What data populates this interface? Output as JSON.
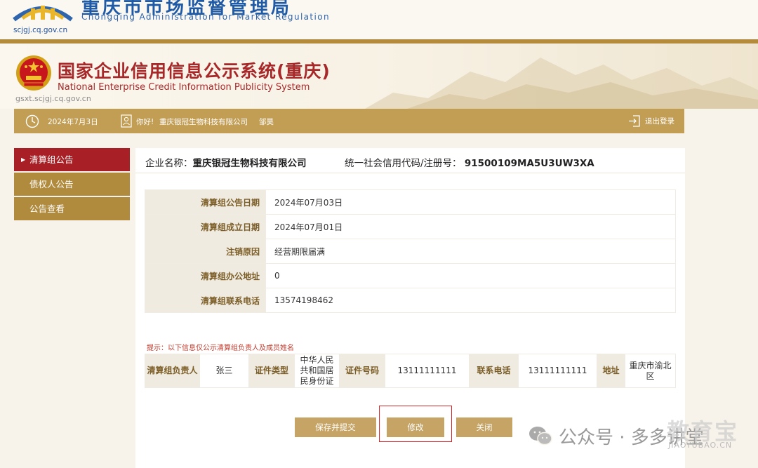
{
  "top_banner": {
    "title_cn": "重庆市市场监督管理局",
    "title_en": "Chongqing  Administration for Market Regulation",
    "url": "scjgj.cq.gov.cn"
  },
  "header": {
    "title": "国家企业信用信息公示系统(重庆)",
    "subtitle_en": "National Enterprise Credit Information Publicity System",
    "url": "gsxt.scjgj.cq.gov.cn"
  },
  "infobar": {
    "date": "2024年7月3日",
    "greeting": "你好!",
    "company": "重庆银冠生物科技有限公司",
    "user": "邹昊",
    "logout_label": "退出登录"
  },
  "sidebar": {
    "items": [
      {
        "label": "清算组公告",
        "active": true
      },
      {
        "label": "债权人公告",
        "active": false
      },
      {
        "label": "公告查看",
        "active": false
      }
    ]
  },
  "company": {
    "name_label": "企业名称：",
    "name": "重庆银冠生物科技有限公司",
    "credit_label": "统一社会信用代码/注册号：",
    "credit_code": "91500109MA5U3UW3XA"
  },
  "details": [
    {
      "label": "清算组公告日期",
      "value": "2024年07月03日"
    },
    {
      "label": "清算组成立日期",
      "value": "2024年07月01日"
    },
    {
      "label": "注销原因",
      "value": "经营期限届满"
    },
    {
      "label": "清算组办公地址",
      "value": "0"
    },
    {
      "label": "清算组联系电话",
      "value": "13574198462"
    }
  ],
  "tip": "提示：以下信息仅公示清算组负责人及成员姓名",
  "members": {
    "leader_label": "清算组负责人",
    "leader": "张三",
    "id_type_label": "证件类型",
    "id_type": "中华人民共和国居民身份证",
    "id_no_label": "证件号码",
    "id_no": "13111111111",
    "phone_label": "联系电话",
    "phone": "13111111111",
    "address_label": "地址",
    "address": "重庆市渝北区"
  },
  "buttons": {
    "submit": "保存并提交",
    "edit": "修改",
    "close": "关闭"
  },
  "watermark": {
    "text": "公众号 · 多多讲堂",
    "brand": "教育宝",
    "brand_sub": "JIAOYUBAO.CN"
  },
  "colors": {
    "brand_gold": "#c29d54",
    "active_red": "#a82025",
    "title_red": "#a8282a",
    "banner_blue": "#1f5aa6"
  }
}
